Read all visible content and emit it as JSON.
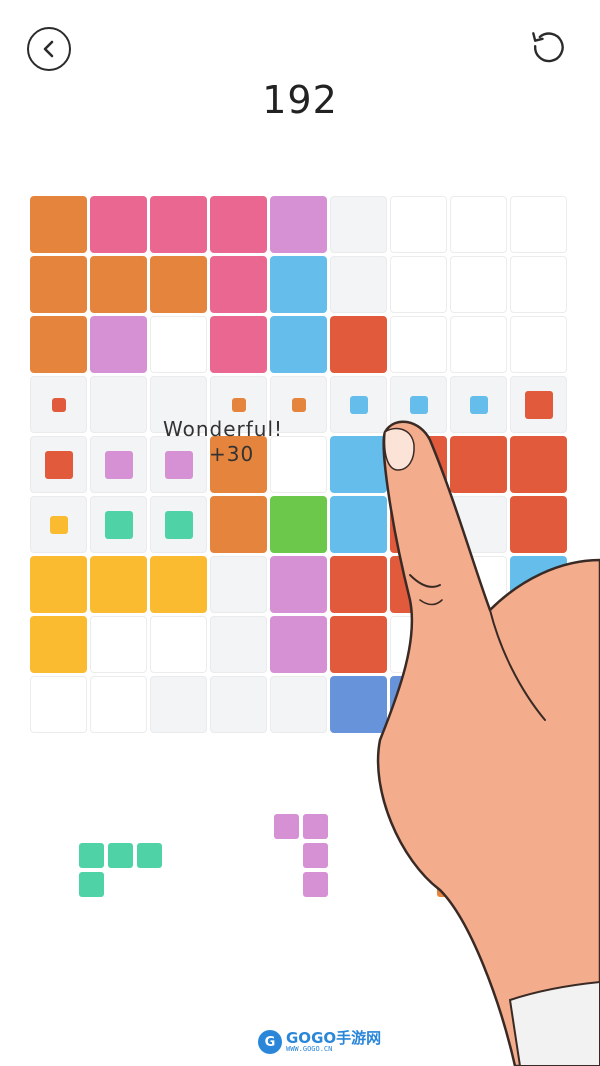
{
  "header": {
    "back_icon": "chevron-left-icon",
    "restart_icon": "restart-icon",
    "score": "192"
  },
  "board": {
    "size": 9,
    "colors": {
      "O": "#e5843c",
      "P": "#e96791",
      "V": "#d591d3",
      "B": "#64bdea",
      "R": "#e15a3c",
      "Y": "#fbbb30",
      "G": "#6bc84b",
      "T": "#4fd3a6",
      "D": "#6793da",
      "W": "#ffffff",
      "E": "#f2f4f5"
    },
    "rows": [
      "OPPPVEWWW",
      "OOOPBEWWW",
      "OVWPBRWWW",
      "EEEEEEEEE",
      "EEEOWBRRR",
      "EEEOGBRER",
      "YYYEVRRWB",
      "YWWEVRWWW",
      "WWEEEDDWW"
    ],
    "markers": [
      {
        "row": 3,
        "col": 0,
        "color": "R",
        "size": "small"
      },
      {
        "row": 3,
        "col": 3,
        "color": "O",
        "size": "small"
      },
      {
        "row": 3,
        "col": 4,
        "color": "O",
        "size": "small"
      },
      {
        "row": 3,
        "col": 5,
        "color": "B",
        "size": "medium"
      },
      {
        "row": 3,
        "col": 6,
        "color": "B",
        "size": "medium"
      },
      {
        "row": 3,
        "col": 7,
        "color": "B",
        "size": "medium"
      },
      {
        "row": 3,
        "col": 8,
        "color": "R",
        "size": "large"
      },
      {
        "row": 4,
        "col": 0,
        "color": "R",
        "size": "large"
      },
      {
        "row": 4,
        "col": 1,
        "color": "V",
        "size": "large"
      },
      {
        "row": 4,
        "col": 2,
        "color": "V",
        "size": "large"
      },
      {
        "row": 5,
        "col": 0,
        "color": "Y",
        "size": "medium"
      },
      {
        "row": 5,
        "col": 1,
        "color": "T",
        "size": "large"
      },
      {
        "row": 5,
        "col": 2,
        "color": "T",
        "size": "large"
      }
    ]
  },
  "feedback": {
    "message": "Wonderful!",
    "points": "+30"
  },
  "pieces": [
    {
      "name": "piece-green-l",
      "color": "T",
      "cells": [
        [
          0,
          0
        ],
        [
          0,
          1
        ],
        [
          0,
          2
        ],
        [
          1,
          0
        ]
      ]
    },
    {
      "name": "piece-purple-j",
      "color": "V",
      "cells": [
        [
          0,
          0
        ],
        [
          0,
          1
        ],
        [
          1,
          1
        ],
        [
          2,
          1
        ]
      ]
    },
    {
      "name": "piece-orange-l",
      "color": "O",
      "cells": [
        [
          0,
          1
        ],
        [
          1,
          0
        ],
        [
          1,
          1
        ],
        [
          1,
          2
        ]
      ]
    }
  ],
  "watermark": {
    "brand": "GOGO手游网",
    "url": "WWW.GOGO.CN"
  }
}
